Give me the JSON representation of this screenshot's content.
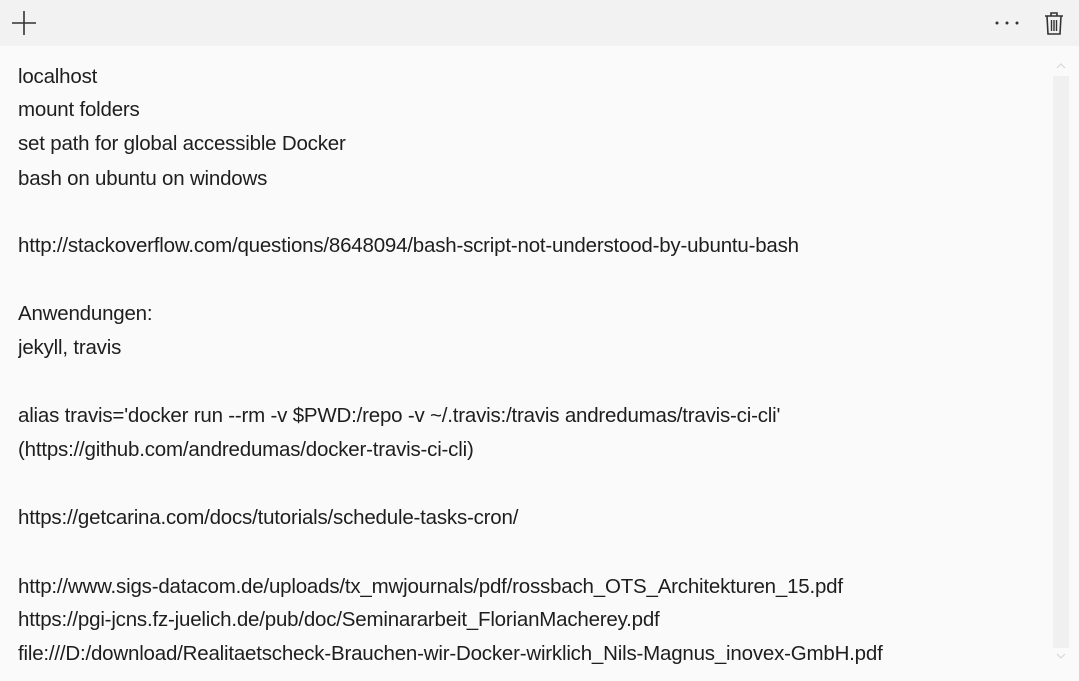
{
  "toolbar": {
    "add_icon": "plus-icon",
    "more_icon": "ellipsis-icon",
    "more_label": "···",
    "delete_icon": "trash-icon"
  },
  "note": {
    "lines": [
      "localhost",
      "mount folders",
      "set path for global accessible Docker",
      "bash on ubuntu on windows",
      "",
      "http://stackoverflow.com/questions/8648094/bash-script-not-understood-by-ubuntu-bash",
      "",
      "Anwendungen:",
      "jekyll, travis",
      "",
      "alias travis='docker run --rm -v $PWD:/repo -v ~/.travis:/travis andredumas/travis-ci-cli'",
      "(https://github.com/andredumas/docker-travis-ci-cli)",
      "",
      "https://getcarina.com/docs/tutorials/schedule-tasks-cron/",
      "",
      "http://www.sigs-datacom.de/uploads/tx_mwjournals/pdf/rossbach_OTS_Architekturen_15.pdf",
      "https://pgi-jcns.fz-juelich.de/pub/doc/Seminararbeit_FlorianMacherey.pdf",
      "file:///D:/download/Realitaetscheck-Brauchen-wir-Docker-wirklich_Nils-Magnus_inovex-GmbH.pdf"
    ]
  },
  "colors": {
    "toolbar_bg": "#f2f2f2",
    "note_bg": "#fafafa",
    "text": "#1e1e1e"
  }
}
